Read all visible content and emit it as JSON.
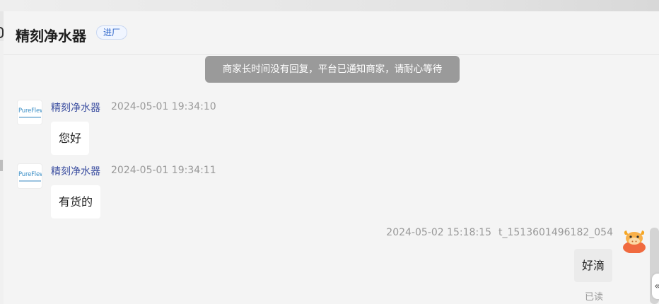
{
  "header": {
    "shop_name": "精刻净水器",
    "badge": "进厂"
  },
  "notice": "商家长时间没有回复，平台已通知商家，请耐心等待",
  "messages": [
    {
      "sender": "精刻净水器",
      "time": "2024-05-01 19:34:10",
      "text": "您好",
      "avatar_text": "PureFlewz"
    },
    {
      "sender": "精刻净水器",
      "time": "2024-05-01 19:34:11",
      "text": "有货的",
      "avatar_text": "PureFlewz"
    },
    {
      "sender": "t_1513601496182_054",
      "time": "2024-05-02 15:18:15",
      "text": "好滴",
      "status": "已读"
    }
  ],
  "icons": {
    "collapse": "double-chevron-left-icon",
    "self_avatar": "cow-avatar-icon"
  },
  "colors": {
    "sender_name": "#3b4ea0",
    "badge_text": "#2c64c9",
    "notice_bg": "#9a9a9a"
  }
}
